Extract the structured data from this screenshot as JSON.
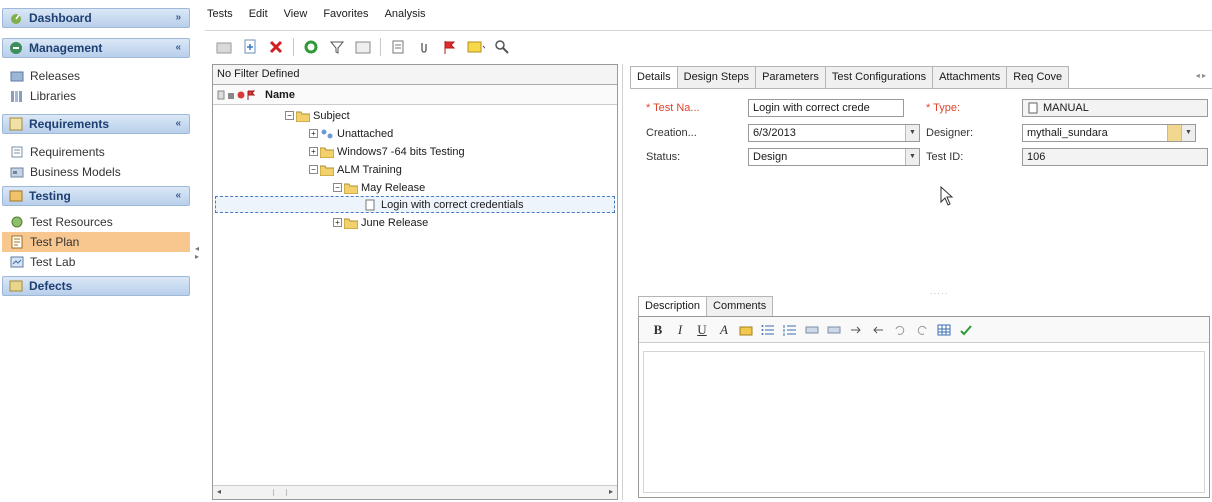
{
  "menu": [
    "Tests",
    "Edit",
    "View",
    "Favorites",
    "Analysis"
  ],
  "sidebar": {
    "sections": [
      {
        "label": "Dashboard",
        "chevron": "»",
        "icon": "dashboard-icon"
      },
      {
        "label": "Management",
        "chevron": "«",
        "icon": "management-icon"
      },
      {
        "label": "Requirements",
        "chevron": "«",
        "icon": "requirements-icon"
      },
      {
        "label": "Testing",
        "chevron": "«",
        "icon": "testing-icon"
      },
      {
        "label": "Defects",
        "icon": "defects-icon"
      }
    ],
    "items": [
      {
        "label": "Releases",
        "icon": "releases-icon"
      },
      {
        "label": "Libraries",
        "icon": "libraries-icon"
      },
      {
        "label": "Requirements",
        "icon": "requirements-module-icon"
      },
      {
        "label": "Business Models",
        "icon": "business-models-icon"
      },
      {
        "label": "Test Resources",
        "icon": "test-resources-icon"
      },
      {
        "label": "Test Plan",
        "icon": "test-plan-icon",
        "active": true
      },
      {
        "label": "Test Lab",
        "icon": "test-lab-icon"
      }
    ]
  },
  "tree": {
    "filter": "No Filter Defined",
    "column_name": "Name",
    "nodes": [
      {
        "label": "Subject",
        "expander": "−"
      },
      {
        "label": "Unattached",
        "expander": "+"
      },
      {
        "label": "Windows7 -64 bits Testing",
        "expander": "+"
      },
      {
        "label": "ALM Training",
        "expander": "−"
      },
      {
        "label": "May Release",
        "expander": "−"
      },
      {
        "label": "Login with correct credentials",
        "selected": true
      },
      {
        "label": "June Release",
        "expander": "+"
      }
    ]
  },
  "details": {
    "tabs": [
      "Details",
      "Design Steps",
      "Parameters",
      "Test Configurations",
      "Attachments",
      "Req Cove"
    ],
    "active_tab": "Details",
    "fields": {
      "test_name_label": "* Test Na...",
      "test_name_value": "Login with correct crede",
      "type_label": "* Type:",
      "type_value": "MANUAL",
      "creation_label": "Creation...",
      "creation_value": "6/3/2013",
      "designer_label": "Designer:",
      "designer_value": "mythali_sundara",
      "status_label": "Status:",
      "status_value": "Design",
      "test_id_label": "Test ID:",
      "test_id_value": "106"
    },
    "desc_tabs": [
      "Description",
      "Comments"
    ],
    "rtf_buttons": [
      "B",
      "I",
      "U",
      "A"
    ]
  },
  "colors": {
    "section_header_bg": "#c6d9f0",
    "active_item_bg": "#f8c68f",
    "required_label": "#e0442a",
    "selection_border": "#4a7cc0"
  }
}
